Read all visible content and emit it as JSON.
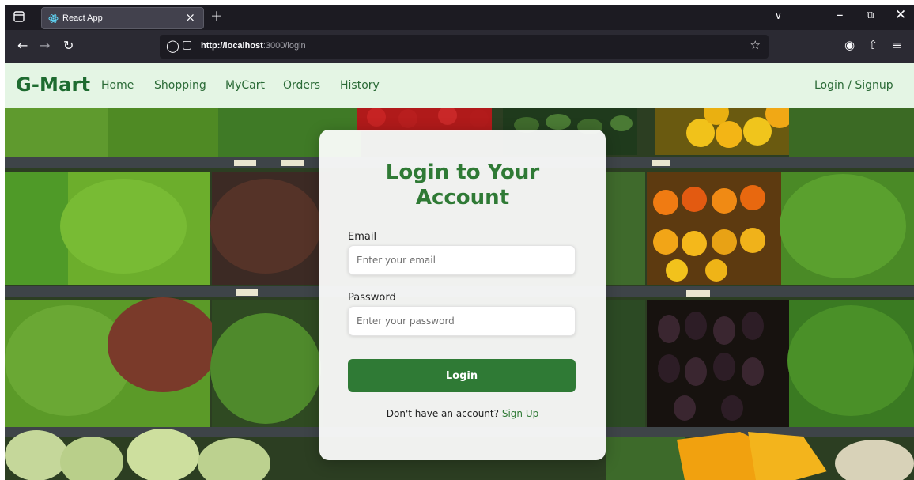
{
  "browser": {
    "tab_title": "React App",
    "url_host": "http://localhost",
    "url_rest": ":3000/login",
    "tab_close": "×",
    "new_tab": "+"
  },
  "site": {
    "brand": "G-Mart",
    "nav": {
      "home": "Home",
      "shopping": "Shopping",
      "mycart": "MyCart",
      "orders": "Orders",
      "history": "History",
      "login_signup": "Login / Signup"
    }
  },
  "login": {
    "title_line1": "Login to Your",
    "title_line2": "Account",
    "email_label": "Email",
    "email_placeholder": "Enter your email",
    "password_label": "Password",
    "password_placeholder": "Enter your password",
    "button": "Login",
    "no_account": "Don't have an account?",
    "signup_link": "Sign Up"
  },
  "colors": {
    "accent": "#2f7a35",
    "nav_bg": "#e4f5e4",
    "browser_dark": "#1c1b22"
  }
}
